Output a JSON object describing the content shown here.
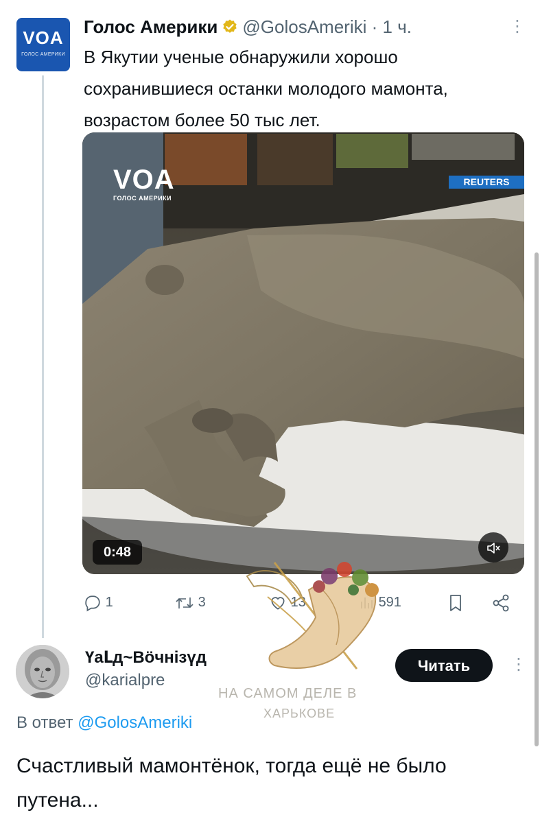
{
  "tweet": {
    "author_name": "Голос Америки",
    "author_handle": "@GolosAmeriki",
    "separator": "·",
    "time": "1 ч.",
    "avatar_logo_text": "VOA",
    "avatar_sub_text": "ГОЛОС АМЕРИКИ",
    "text": "В Якутии ученые обнаружили хорошо сохранившиеся останки молодого мамонта, возрастом более 50 тыс лет.",
    "more_icon": "more-vertical-icon",
    "media": {
      "duration": "0:48",
      "watermark_logo": "VOA",
      "watermark_sub": "ГОЛОС АМЕРИКИ",
      "source_tag": "REUTERS",
      "mute_icon": "speaker-muted-icon"
    },
    "actions": {
      "replies": "1",
      "reposts": "3",
      "likes": "13",
      "views": "591",
      "bookmark_icon": "bookmark-icon",
      "share_icon": "share-icon"
    }
  },
  "reply": {
    "author_name": "ҮаԼд~Вӧчнiзүд",
    "author_handle": "@karialpre",
    "follow_label": "Читать",
    "reply_prefix": "В ответ",
    "reply_mention": "@GolosAmeriki",
    "text": "Счастливый мамонтёнок, тогда ещё не было путена..."
  },
  "watermark": {
    "line1": "НА САМОМ ДЕЛЕ В",
    "line2": "ХАРЬКОВЕ"
  },
  "colors": {
    "text_primary": "#0f1419",
    "text_secondary": "#536471",
    "link": "#1d9bf0",
    "verified_badge": "#e2b719",
    "voa_blue": "#1a56b0"
  }
}
